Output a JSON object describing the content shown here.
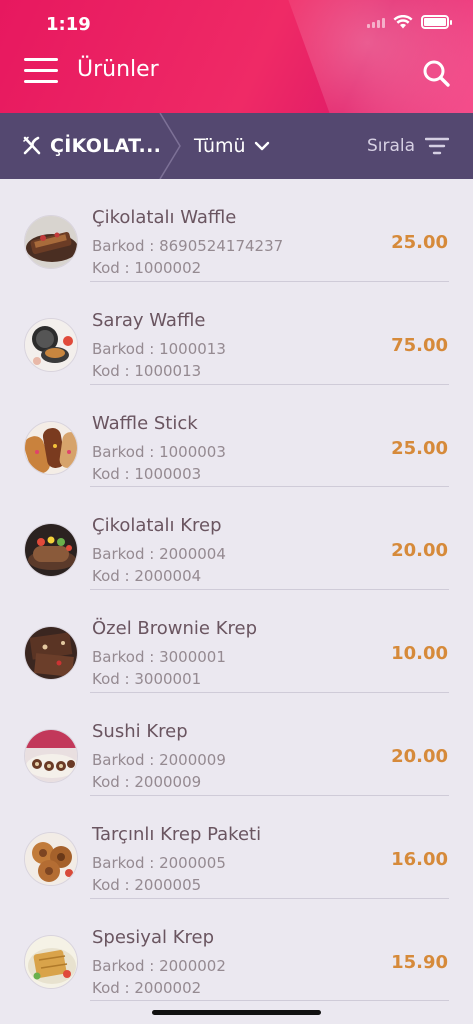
{
  "status": {
    "time": "1:19"
  },
  "header": {
    "title": "Ürünler"
  },
  "filter": {
    "category": "ÇİKOLAT...",
    "subcategory": "Tümü",
    "sort_label": "Sırala"
  },
  "colors": {
    "header": "#e7185f",
    "filter_bar": "#544870",
    "price": "#d68a3a",
    "background": "#ebe8f0"
  },
  "products": [
    {
      "name": "Çikolatalı Waffle",
      "barcode": "Barkod : 8690524174237",
      "code": "Kod : 1000002",
      "price": "25.00",
      "image": "chocolate-waffle"
    },
    {
      "name": "Saray Waffle",
      "barcode": "Barkod : 1000013",
      "code": "Kod : 1000013",
      "price": "75.00",
      "image": "waffle-maker"
    },
    {
      "name": "Waffle Stick",
      "barcode": "Barkod : 1000003",
      "code": "Kod : 1000003",
      "price": "25.00",
      "image": "waffle-sticks"
    },
    {
      "name": "Çikolatalı Krep",
      "barcode": "Barkod : 2000004",
      "code": "Kod : 2000004",
      "price": "20.00",
      "image": "chocolate-crepe"
    },
    {
      "name": "Özel Brownie Krep",
      "barcode": "Barkod : 3000001",
      "code": "Kod : 3000001",
      "price": "10.00",
      "image": "brownie-crepe"
    },
    {
      "name": "Sushi Krep",
      "barcode": "Barkod : 2000009",
      "code": "Kod : 2000009",
      "price": "20.00",
      "image": "sushi-crepe"
    },
    {
      "name": "Tarçınlı Krep Paketi",
      "barcode": "Barkod : 2000005",
      "code": "Kod : 2000005",
      "price": "16.00",
      "image": "cinnamon-crepe"
    },
    {
      "name": "Spesiyal Krep",
      "barcode": "Barkod : 2000002",
      "code": "Kod : 2000002",
      "price": "15.90",
      "image": "special-crepe"
    }
  ]
}
